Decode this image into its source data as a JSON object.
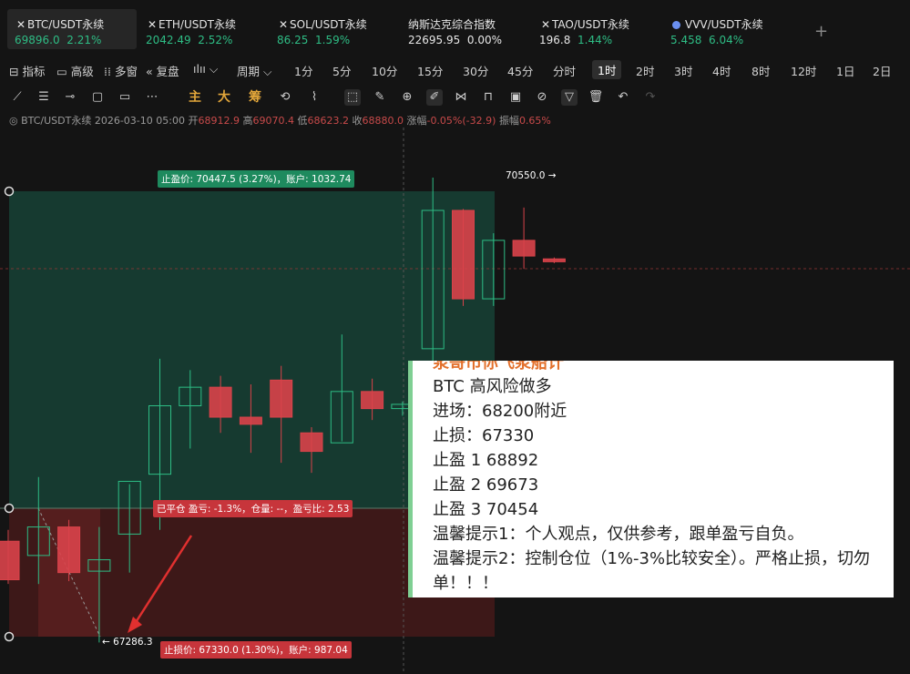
{
  "tickers": [
    {
      "name": "BTC/USDT永续",
      "price": "69896.0",
      "change": "2.21%",
      "icon": "x-icon",
      "active": true
    },
    {
      "name": "ETH/USDT永续",
      "price": "2042.49",
      "change": "2.52%",
      "icon": "x-icon"
    },
    {
      "name": "SOL/USDT永续",
      "price": "86.25",
      "change": "1.59%",
      "icon": "x-icon"
    },
    {
      "name": "纳斯达克综合指数",
      "price": "22695.95",
      "change": "0.00%"
    },
    {
      "name": "TAO/USDT永续",
      "price": "196.8",
      "change": "1.44%",
      "icon": "x-icon"
    },
    {
      "name": "VVV/USDT永续",
      "price": "5.458",
      "change": "6.04%",
      "icon": "dot-icon"
    }
  ],
  "add_tab_label": "+",
  "toolbar": {
    "indicator": "指标",
    "advanced": "高级",
    "multi_window": "多窗",
    "replay": "复盘",
    "chart_style": "ılıı",
    "period": "周期",
    "intervals": [
      "1分",
      "5分",
      "10分",
      "15分",
      "30分",
      "45分",
      "分时",
      "1时",
      "2时",
      "3时",
      "4时",
      "8时",
      "12时",
      "1日",
      "2日"
    ],
    "selected_interval": "1时"
  },
  "drawing_tools": {
    "main": "主",
    "big": "大",
    "chips": "筹"
  },
  "info": {
    "symbol": "BTC/USDT永续",
    "time": "2026-03-10 05:00",
    "open_label": "开",
    "open": "68912.9",
    "high_label": "高",
    "high": "69070.4",
    "low_label": "低",
    "low": "68623.2",
    "close_label": "收",
    "close": "68880.0",
    "change_label": "涨幅",
    "change": "-0.05%(-32.9)",
    "amp_label": "振幅",
    "amp": "0.65%"
  },
  "chart": {
    "tp_label": "止盈价: 70447.5 (3.27%)，账户: 1032.74",
    "closed_label": "已平仓 盈亏: -1.3%，仓量: --，盈亏比: 2.53",
    "sl_label": "止损价: 67330.0 (1.30%)，账户: 987.04",
    "high_marker": "70550.0 →",
    "low_marker": "← 67286.3",
    "colors": {
      "up": "#2ebd85",
      "down": "#d9434a",
      "tp_zone": "#163a30",
      "sl_zone": "#3d1818"
    }
  },
  "chart_data": {
    "type": "candlestick",
    "candles": [
      {
        "o": 68000,
        "h": 68080,
        "l": 67700,
        "c": 67730
      },
      {
        "o": 67900,
        "h": 68450,
        "l": 67700,
        "c": 68100
      },
      {
        "o": 68100,
        "h": 68150,
        "l": 67720,
        "c": 67780
      },
      {
        "o": 67790,
        "h": 68100,
        "l": 67290,
        "c": 67870
      },
      {
        "o": 68050,
        "h": 68400,
        "l": 67780,
        "c": 68420
      },
      {
        "o": 68470,
        "h": 69280,
        "l": 68080,
        "c": 68950
      },
      {
        "o": 68950,
        "h": 69200,
        "l": 68650,
        "c": 69080
      },
      {
        "o": 69080,
        "h": 69160,
        "l": 68760,
        "c": 68870
      },
      {
        "o": 68870,
        "h": 69100,
        "l": 68620,
        "c": 68820
      },
      {
        "o": 69130,
        "h": 69230,
        "l": 68550,
        "c": 68870
      },
      {
        "o": 68760,
        "h": 68800,
        "l": 68480,
        "c": 68630
      },
      {
        "o": 68690,
        "h": 69450,
        "l": 68700,
        "c": 69050
      },
      {
        "o": 69050,
        "h": 69140,
        "l": 68850,
        "c": 68930
      },
      {
        "o": 68930,
        "h": 68980,
        "l": 68880,
        "c": 68960
      },
      {
        "o": 69350,
        "h": 70550,
        "l": 69070,
        "c": 70320
      },
      {
        "o": 70320,
        "h": 70330,
        "l": 69650,
        "c": 69700
      },
      {
        "o": 69700,
        "h": 70160,
        "l": 69650,
        "c": 70110
      },
      {
        "o": 70110,
        "h": 70340,
        "l": 69910,
        "c": 70000
      },
      {
        "o": 69980,
        "h": 69990,
        "l": 69950,
        "c": 69960
      }
    ]
  },
  "overlay": {
    "lines": [
      "浆哥市你飞浆船计",
      "BTC 高风险做多",
      "进场：68200附近",
      "止损：67330",
      "止盈 1   68892",
      "止盈 2  69673",
      "止盈 3  70454",
      "温馨提示1：个人观点，仅供参考，跟单盈亏自负。",
      "温馨提示2：控制仓位（1%-3%比较安全）。严格止损，切勿",
      "单！！！"
    ]
  }
}
